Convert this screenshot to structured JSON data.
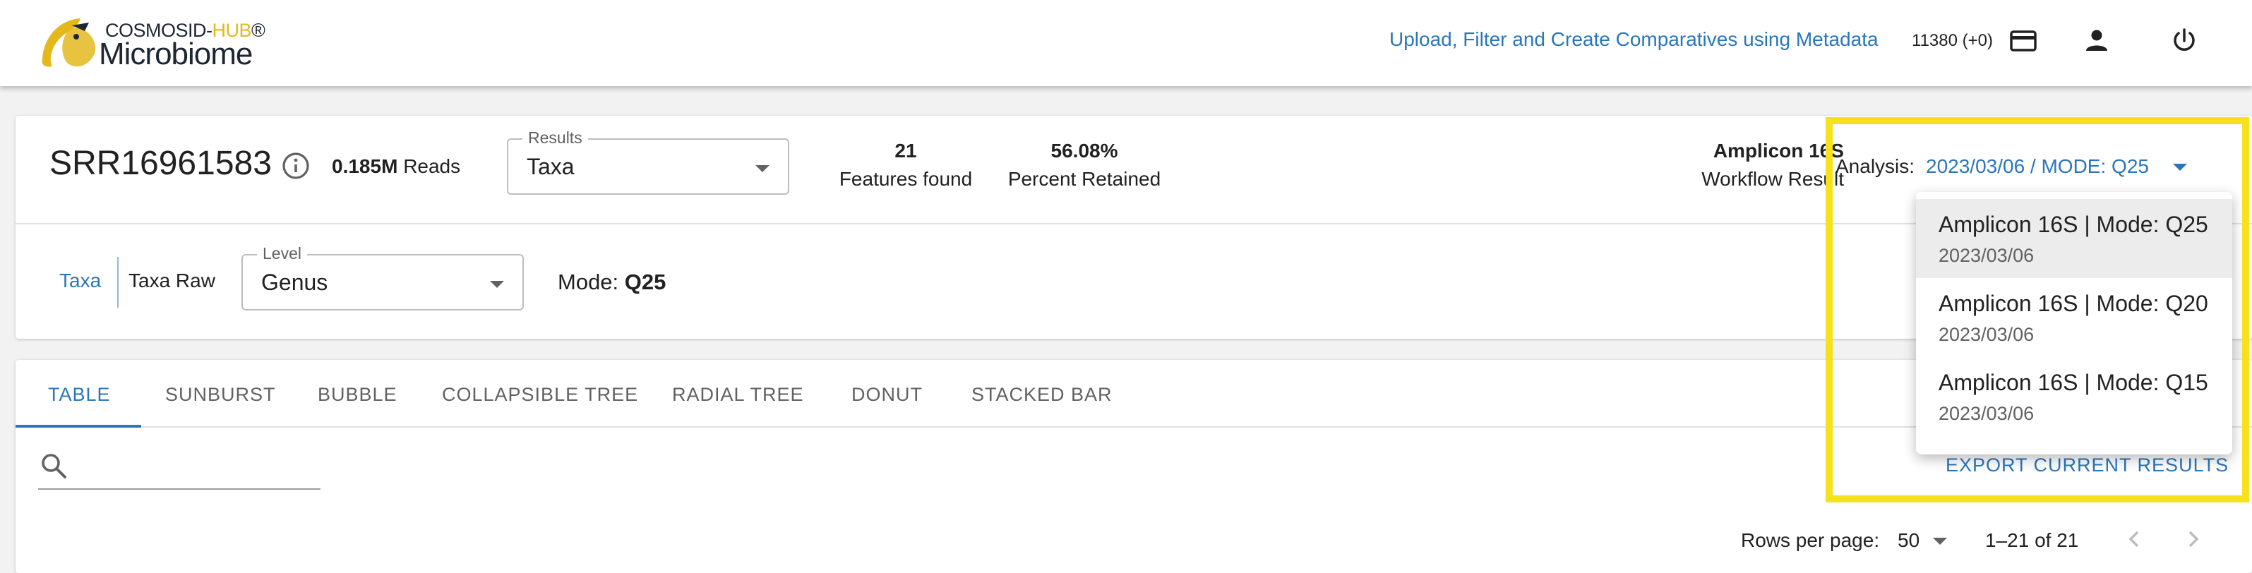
{
  "header": {
    "logo_top": "COSMOSID-",
    "logo_top_accent": "HUB",
    "logo_top_reg": "®",
    "logo_bottom": "Microbiome",
    "metadata_link": "Upload, Filter and Create Comparatives using Metadata",
    "credits": "11380 (+0)",
    "icons": [
      "credit-card-icon",
      "user-icon",
      "power-icon"
    ]
  },
  "sample": {
    "id": "SRR16961583",
    "reads_value": "0.185M",
    "reads_label": "Reads",
    "results_legend": "Results",
    "results_value": "Taxa",
    "features_count": "21",
    "features_label": "Features found",
    "percent_retained": "56.08%",
    "percent_label": "Percent Retained",
    "workflow_name": "Amplicon 16S",
    "workflow_label": "Workflow Result",
    "analysis_label": "Analysis:",
    "analysis_value": "2023/03/06 / MODE: Q25"
  },
  "filters": {
    "taxa_label": "Taxa",
    "taxa_raw_label": "Taxa Raw",
    "level_legend": "Level",
    "level_value": "Genus",
    "mode_label": "Mode:",
    "mode_value": "Q25"
  },
  "tabs": [
    {
      "label": "TABLE",
      "active": true
    },
    {
      "label": "SUNBURST"
    },
    {
      "label": "BUBBLE"
    },
    {
      "label": "COLLAPSIBLE TREE"
    },
    {
      "label": "RADIAL TREE"
    },
    {
      "label": "DONUT"
    },
    {
      "label": "STACKED BAR"
    }
  ],
  "table": {
    "search_placeholder": "",
    "export_label": "EXPORT CURRENT RESULTS",
    "rows_per_page_label": "Rows per page:",
    "rows_per_page_value": "50",
    "range": "1–21 of 21"
  },
  "analysis_menu": {
    "items": [
      {
        "title": "Amplicon 16S | Mode: Q25",
        "date": "2023/03/06",
        "selected": true
      },
      {
        "title": "Amplicon 16S | Mode: Q20",
        "date": "2023/03/06"
      },
      {
        "title": "Amplicon 16S | Mode: Q15",
        "date": "2023/03/06"
      }
    ]
  },
  "colors": {
    "accent": "#2a76bb",
    "logo_gold": "#e3b81d",
    "highlight": "#f5e11c"
  }
}
